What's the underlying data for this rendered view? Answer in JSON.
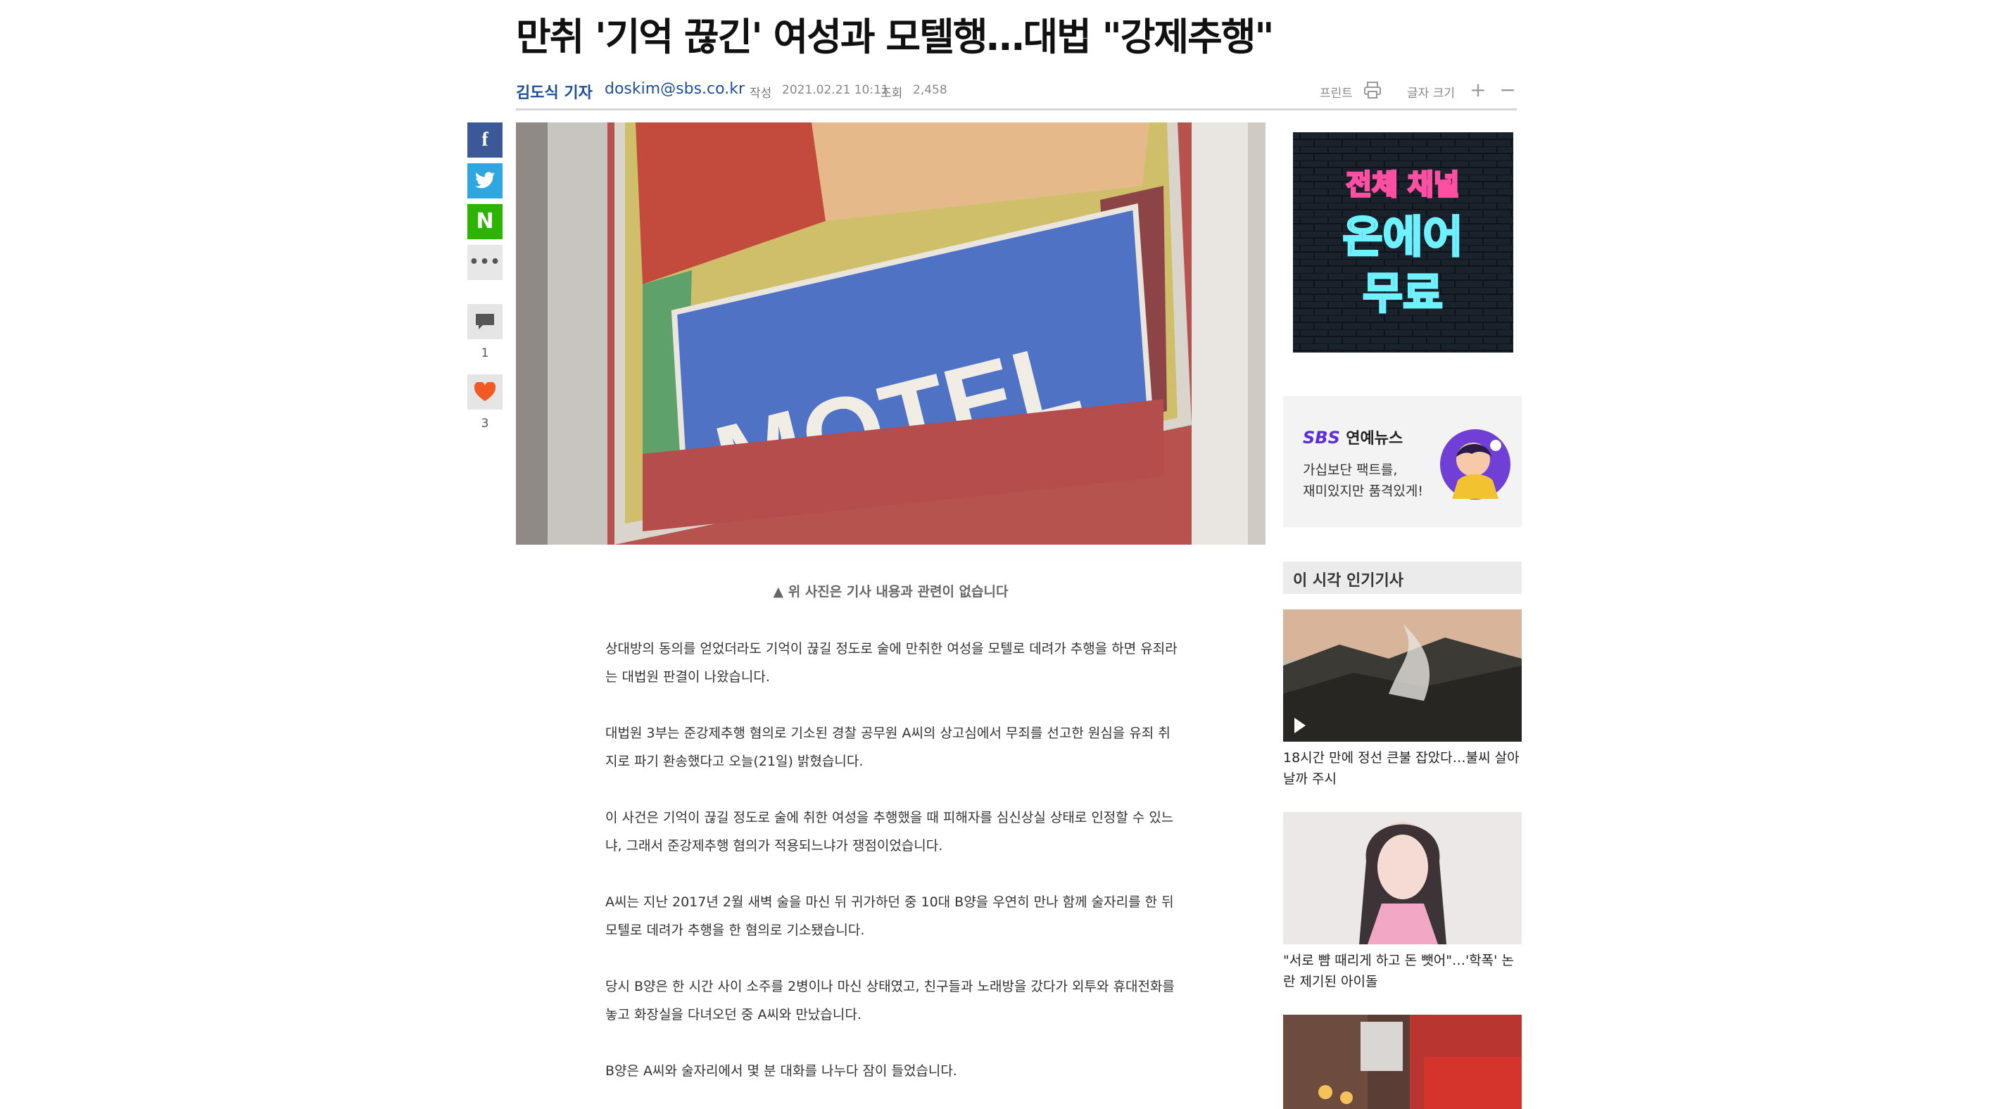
{
  "article": {
    "headline": "만취 '기억 끊긴' 여성과 모텔행…대법 \"강제추행\"",
    "reporter": "김도식 기자",
    "email": "doskim@sbs.co.kr",
    "written_label": "작성",
    "written_value": "2021.02.21 10:11",
    "views_label": "조회",
    "views_value": "2,458",
    "print_label": "프린트",
    "font_size_label": "글자 크기",
    "photo_sign_text": "MOTEL",
    "caption": "▲ 위 사진은 기사 내용과 관련이 없습니다",
    "paragraphs": [
      "상대방의 동의를 얻었더라도 기억이 끊길 정도로 술에 만취한 여성을 모텔로 데려가 추행을 하면 유죄라는 대법원 판결이 나왔습니다.",
      "대법원 3부는 준강제추행 혐의로 기소된 경찰 공무원 A씨의 상고심에서 무죄를 선고한 원심을 유죄 취지로 파기 환송했다고 오늘(21일) 밝혔습니다.",
      "이 사건은 기억이 끊길 정도로 술에 취한 여성을 추행했을 때 피해자를 심신상실 상태로 인정할 수 있느냐, 그래서 준강제추행 혐의가 적용되느냐가 쟁점이었습니다.",
      "A씨는 지난 2017년 2월 새벽 술을 마신 뒤 귀가하던 중 10대 B양을 우연히 만나 함께 술자리를 한 뒤 모텔로 데려가 추행을 한 혐의로 기소됐습니다.",
      "당시 B양은 한 시간 사이 소주를 2병이나 마신 상태였고, 친구들과 노래방을 갔다가 외투와 휴대전화를 놓고 화장실을 다녀오던 중 A씨와 만났습니다.",
      "B양은 A씨와 술자리에서 몇 분 대화를 나누다 잠이 들었습니다."
    ]
  },
  "share": {
    "facebook_glyph": "f",
    "twitter_glyph": "🐦",
    "naver_glyph": "N",
    "more_glyph": "•••",
    "comment_count": "1",
    "like_count": "3"
  },
  "sidebar": {
    "ad_line1": "전체 채널",
    "ad_line2": "온에어",
    "ad_line3": "무료",
    "promo_brand_sbs": "SBS",
    "promo_brand_rest": "연예뉴스",
    "promo_line1": "가십보단 팩트를,",
    "promo_line2": "재미있지만 품격있게!",
    "popular_title": "이 시각 인기기사",
    "popular": [
      {
        "title": "18시간 만에 정선 큰불 잡았다…불씨 살아날까 주시"
      },
      {
        "title": "\"서로 뺨 때리게 하고 돈 뺏어\"…'학폭' 논란 제기된 아이돌"
      },
      {
        "title": ""
      }
    ]
  },
  "colors": {
    "link_blue": "#1f4e9b",
    "facebook": "#3b5998",
    "twitter": "#2ea7e0",
    "naver": "#2db400",
    "heart": "#f15a22",
    "neon_pink": "#ff4fa3",
    "neon_cyan": "#6ff2ff"
  }
}
